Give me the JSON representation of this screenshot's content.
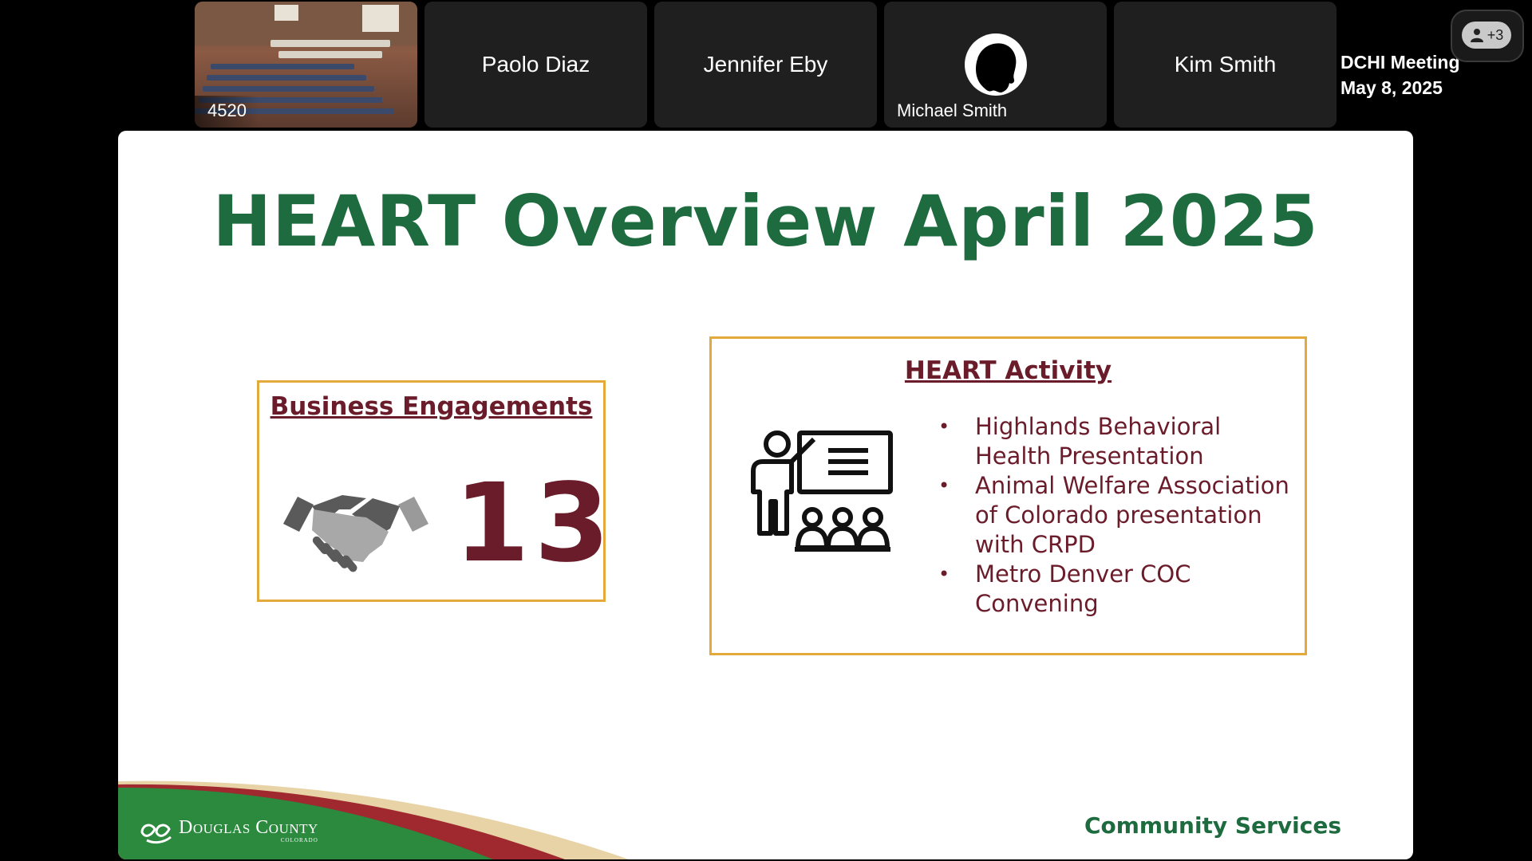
{
  "participants": [
    {
      "name": "4520",
      "type": "video"
    },
    {
      "name": "Paolo Diaz",
      "type": "name"
    },
    {
      "name": "Jennifer Eby",
      "type": "name"
    },
    {
      "name": "Michael Smith",
      "type": "avatar"
    },
    {
      "name": "Kim Smith",
      "type": "name"
    }
  ],
  "more_participants": {
    "label": "+3",
    "icon": "person-icon"
  },
  "meeting": {
    "title": "DCHI Meeting",
    "date": "May 8, 2025"
  },
  "slide": {
    "title": "HEART Overview April 2025",
    "engagements": {
      "heading": "Business Engagements",
      "count": "13",
      "icon": "handshake-icon"
    },
    "activity": {
      "heading": "HEART Activity",
      "icon": "presenter-icon",
      "items": [
        "Highlands Behavioral Health Presentation",
        "Animal Welfare Association of Colorado presentation with CRPD",
        "Metro Denver COC Convening"
      ]
    },
    "footer": {
      "org_name": "Douglas County",
      "org_sub": "COLORADO",
      "department": "Community Services"
    }
  },
  "colors": {
    "title_green": "#1e6b3f",
    "heading_maroon": "#6b1c2a",
    "box_border": "#e3a93a",
    "tile_bg": "#1f1f1f"
  }
}
